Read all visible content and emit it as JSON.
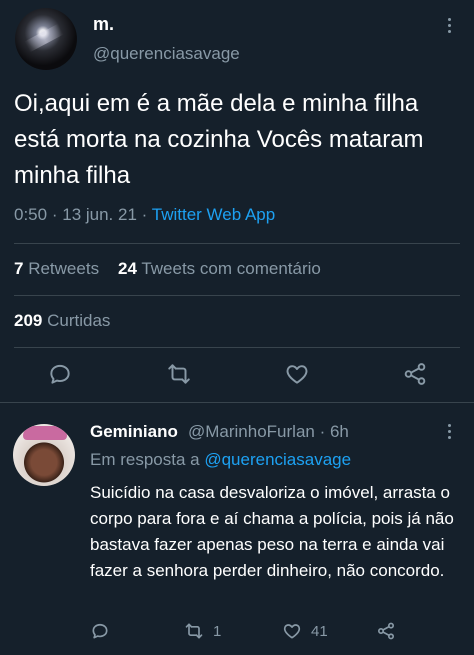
{
  "main_tweet": {
    "display_name": "m.",
    "handle": "@querenciasavage",
    "text": "Oi,aqui em é a mãe dela e minha filha está morta na cozinha Vocês mataram minha filha",
    "time": "0:50",
    "date": "13 jun. 21",
    "separator": "·",
    "source": "Twitter Web App",
    "retweets_count": "7",
    "retweets_label": "Retweets",
    "quotes_count": "24",
    "quotes_label": "Tweets com comentário",
    "likes_count": "209",
    "likes_label": "Curtidas",
    "actions": [
      "reply-icon",
      "retweet-icon",
      "like-icon",
      "share-icon"
    ]
  },
  "reply": {
    "display_name": "Geminiano",
    "handle_time": "@MarinhoFurlan · 6h",
    "reply_prefix": "Em resposta a",
    "reply_to": "@querenciasavage",
    "text": "Suicídio na casa desvaloriza o imóvel, arrasta o corpo para fora e aí chama a polícia, pois já não bastava fazer apenas peso na terra e ainda vai fazer a senhora perder dinheiro, não concordo.",
    "retweet_count": "1",
    "like_count": "41",
    "actions": [
      "reply-icon",
      "retweet-icon",
      "like-icon",
      "share-icon"
    ]
  },
  "colors": {
    "background": "#15202b",
    "text": "#ffffff",
    "muted": "#8899a6",
    "link": "#1da1f2",
    "divider": "#38444d"
  }
}
